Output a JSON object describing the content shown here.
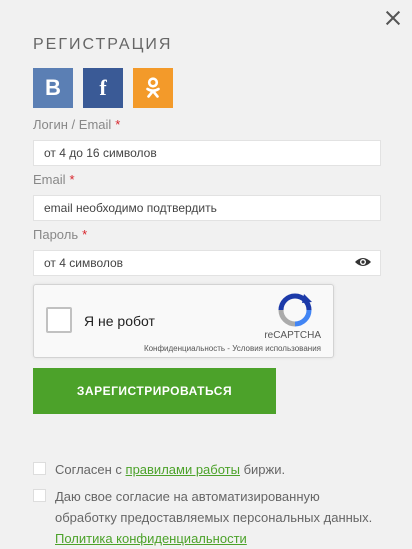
{
  "title": "РЕГИСТРАЦИЯ",
  "social": {
    "vk": "B",
    "fb": "f"
  },
  "login": {
    "label": "Логин / Email",
    "required_mark": "*",
    "placeholder": "от 4 до 16 символов"
  },
  "email": {
    "label": "Email",
    "required_mark": "*",
    "placeholder": "email необходимо подтвердить"
  },
  "password": {
    "label": "Пароль",
    "required_mark": "*",
    "placeholder": "от 4 символов"
  },
  "captcha": {
    "checkbox_label": "Я не робот",
    "brand": "reCAPTCHA",
    "links": "Конфиденциальность - Условия использования"
  },
  "register_button": "ЗАРЕГИСТРИРОВАТЬСЯ",
  "agree_rules": {
    "prefix": "Согласен с ",
    "link": "правилами работы",
    "suffix": " биржи."
  },
  "agree_privacy": {
    "text": "Даю свое согласие на автоматизированную обработку предоставляемых персональных данных. ",
    "link": "Политика конфиденциальности"
  },
  "colors": {
    "accent": "#4ca22a",
    "vk": "#5b7fb4",
    "fb": "#3a5a96",
    "ok": "#f39a2a",
    "required": "#d8232a"
  }
}
